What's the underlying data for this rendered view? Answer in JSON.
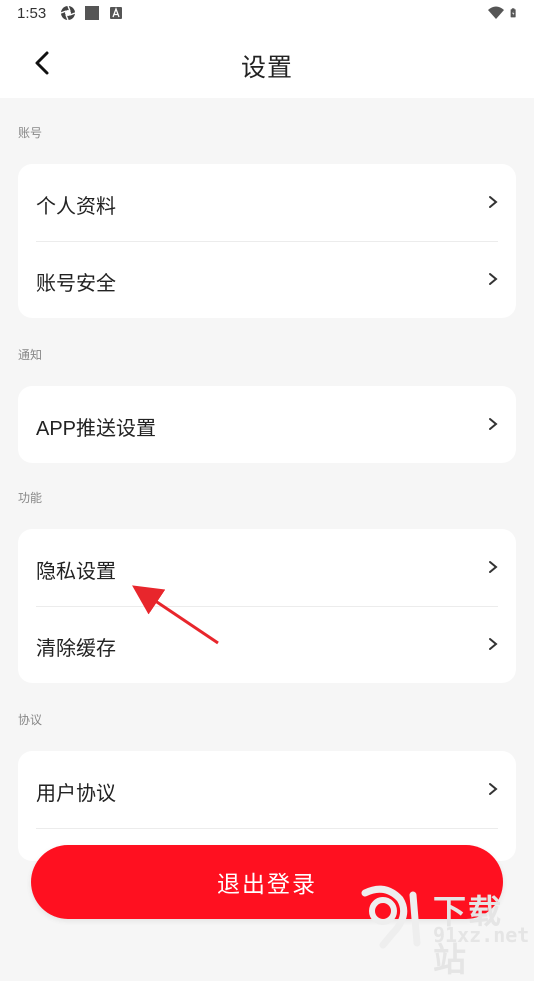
{
  "status_bar": {
    "time": "1:53",
    "icons_left": [
      "aperture-icon",
      "square-icon",
      "font-icon"
    ],
    "icons_right": [
      "wifi-icon",
      "battery-icon"
    ]
  },
  "header": {
    "title": "设置",
    "back_icon": "chevron-left-icon"
  },
  "sections": [
    {
      "label": "账号",
      "items": [
        {
          "label": "个人资料"
        },
        {
          "label": "账号安全"
        }
      ]
    },
    {
      "label": "通知",
      "items": [
        {
          "label": "APP推送设置"
        }
      ]
    },
    {
      "label": "功能",
      "items": [
        {
          "label": "隐私设置"
        },
        {
          "label": "清除缓存"
        }
      ]
    },
    {
      "label": "协议",
      "items": [
        {
          "label": "用户协议"
        }
      ]
    }
  ],
  "logout_button": {
    "label": "退出登录",
    "color": "#ff1020"
  },
  "annotation": {
    "type": "red-arrow",
    "color": "#e8262c",
    "points_to": "隐私设置"
  },
  "watermark": {
    "line1": "下载站",
    "line2": "91xz.net",
    "logo": "91-logo"
  },
  "colors": {
    "background": "#f6f6f6",
    "card": "#ffffff",
    "accent": "#ff1020",
    "text": "#222222",
    "section_label": "#888888"
  }
}
